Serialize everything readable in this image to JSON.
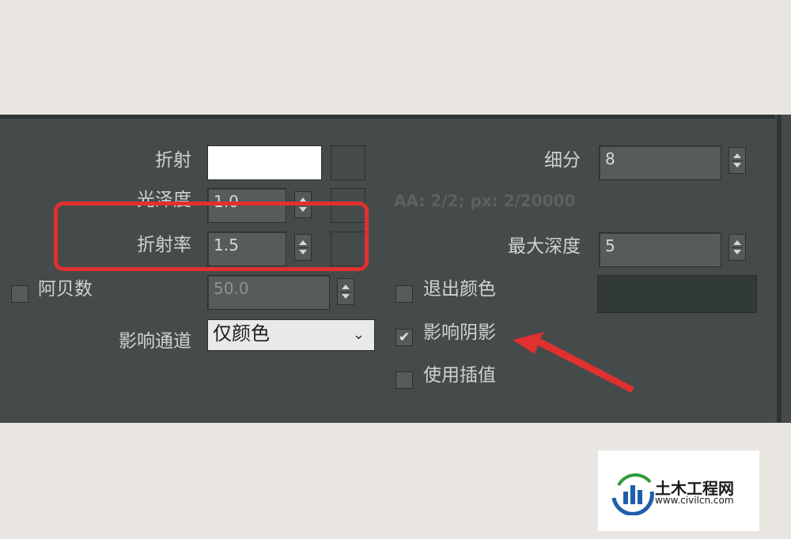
{
  "labels": {
    "refraction": "折射",
    "glossiness": "光泽度",
    "ior": "折射率",
    "abbe": "阿贝数",
    "affect_channels": "影响通道",
    "subdivs": "细分",
    "max_depth": "最大深度",
    "exit_color": "退出颜色",
    "affect_shadows": "影响阴影",
    "use_interpolation": "使用插值"
  },
  "values": {
    "glossiness": "1.0",
    "ior": "1.5",
    "abbe": "50.0",
    "affect_channels": "仅颜色",
    "subdivs": "8",
    "max_depth": "5"
  },
  "info": "AA: 2/2; px: 2/20000",
  "checkboxes": {
    "abbe": false,
    "exit_color": false,
    "affect_shadows": true,
    "use_interpolation": false
  },
  "colors": {
    "refraction_swatch": "#ffffff",
    "exit_color_swatch": "#313939",
    "annotation": "#e03030"
  },
  "watermark": {
    "name": "土木工程网",
    "url": "www.civilcn.com"
  }
}
